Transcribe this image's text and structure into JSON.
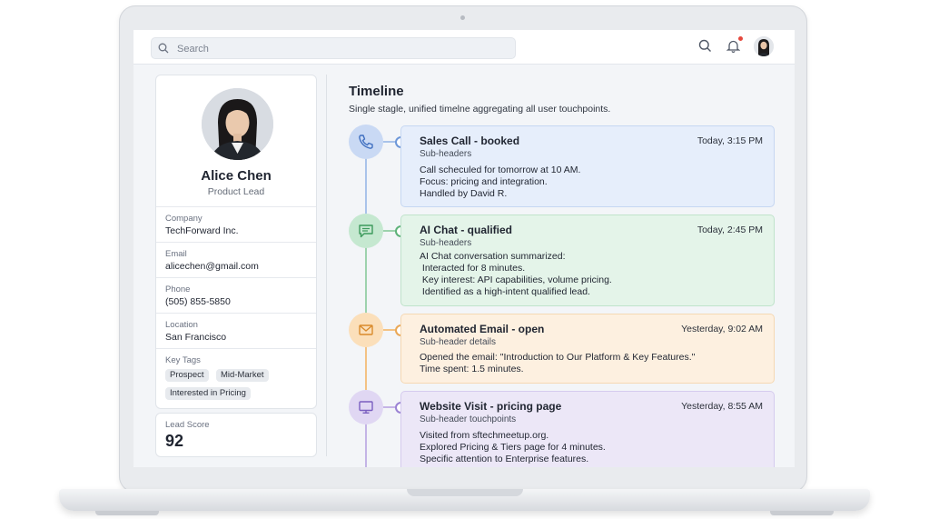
{
  "search": {
    "placeholder": "Search"
  },
  "topbar": {
    "icons": [
      "search-icon",
      "bell-icon",
      "avatar"
    ],
    "notification_dot_color": "#e5483d"
  },
  "profile": {
    "name": "Alice Chen",
    "role": "Product Lead",
    "fields": [
      {
        "label": "Company",
        "value": "TechForward Inc."
      },
      {
        "label": "Email",
        "value": "alicechen@gmail.com"
      },
      {
        "label": "Phone",
        "value": "(505) 855-5850"
      },
      {
        "label": "Location",
        "value": "San Francisco"
      }
    ],
    "tags_label": "Key Tags",
    "tags": [
      "Prospect",
      "Mid-Market",
      "Interested in Pricing"
    ],
    "score_label": "Lead Score",
    "score": "92"
  },
  "timeline": {
    "title": "Timeline",
    "subtitle": "Single stagle, unified timelne aggregating all user touchpoints.",
    "events": [
      {
        "icon": "phone-icon",
        "color": "#8fb2e8",
        "title": "Sales Call - booked",
        "time": "Today, 3:15 PM",
        "sub": "Sub-headers",
        "lines": [
          "Call scheculed for tomorrow at 10 AM.",
          "Focus: pricing and integration.",
          "Handled by David R."
        ]
      },
      {
        "icon": "chat-icon",
        "color": "#86c99b",
        "title": "AI Chat - qualified",
        "time": "Today, 2:45 PM",
        "sub": "Sub-headers",
        "lines": [
          "AI Chat conversation summarized:",
          " Interacted for 8 minutes.",
          " Key interest: API capabilities, volume pricing.",
          " Identified as a high-intent qualified lead."
        ]
      },
      {
        "icon": "email-icon",
        "color": "#f0b46a",
        "title": "Automated Email - open",
        "time": "Yesterday, 9:02 AM",
        "sub": "Sub-header details",
        "lines": [
          "Opened the email: \"Introduction to Our Platform & Key Features.\"",
          "Time spent: 1.5 minutes."
        ]
      },
      {
        "icon": "monitor-icon",
        "color": "#b6a2e0",
        "title": "Website Visit - pricing page",
        "time": "Yesterday, 8:55 AM",
        "sub": "Sub-header touchpoints",
        "lines": [
          "Visited from sftechmeetup.org.",
          "Explored Pricing & Tiers page for 4 minutes.",
          "Specific attention to Enterprise features."
        ]
      }
    ]
  }
}
